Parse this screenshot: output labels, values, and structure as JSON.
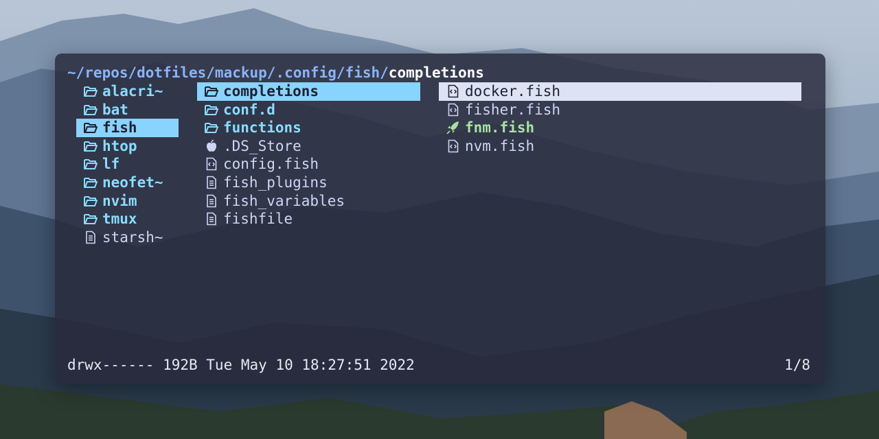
{
  "path": {
    "prefix": "~/repos/dotfiles/mackup/.config/fish/",
    "current": "completions"
  },
  "columns": {
    "parent": [
      {
        "label": "alacri~",
        "icon": "folder-icon"
      },
      {
        "label": "bat",
        "icon": "folder-icon"
      },
      {
        "label": "fish",
        "icon": "folder-icon"
      },
      {
        "label": "htop",
        "icon": "folder-icon"
      },
      {
        "label": "lf",
        "icon": "folder-icon"
      },
      {
        "label": "neofet~",
        "icon": "folder-icon"
      },
      {
        "label": "nvim",
        "icon": "folder-icon"
      },
      {
        "label": "tmux",
        "icon": "folder-icon"
      },
      {
        "label": "starsh~",
        "icon": "document-icon"
      }
    ],
    "current": [
      {
        "label": "completions",
        "icon": "folder-icon"
      },
      {
        "label": "conf.d",
        "icon": "folder-icon"
      },
      {
        "label": "functions",
        "icon": "folder-icon"
      },
      {
        "label": ".DS_Store",
        "icon": "apple-icon"
      },
      {
        "label": "config.fish",
        "icon": "code-file-icon"
      },
      {
        "label": "fish_plugins",
        "icon": "document-icon"
      },
      {
        "label": "fish_variables",
        "icon": "document-icon"
      },
      {
        "label": "fishfile",
        "icon": "document-icon"
      }
    ],
    "preview": [
      {
        "label": "docker.fish",
        "icon": "code-file-icon"
      },
      {
        "label": "fisher.fish",
        "icon": "code-file-icon"
      },
      {
        "label": "fnm.fish",
        "icon": "rocket-icon"
      },
      {
        "label": "nvm.fish",
        "icon": "code-file-icon"
      }
    ]
  },
  "status": {
    "info": "drwx------ 192B Tue May 10 18:27:51 2022",
    "position": "1/8"
  },
  "colors": {
    "directory": "#89dcff",
    "executable": "#a6e3a1",
    "parent_highlight": "#89d3ff",
    "preview_highlight": "#dde3f3"
  }
}
